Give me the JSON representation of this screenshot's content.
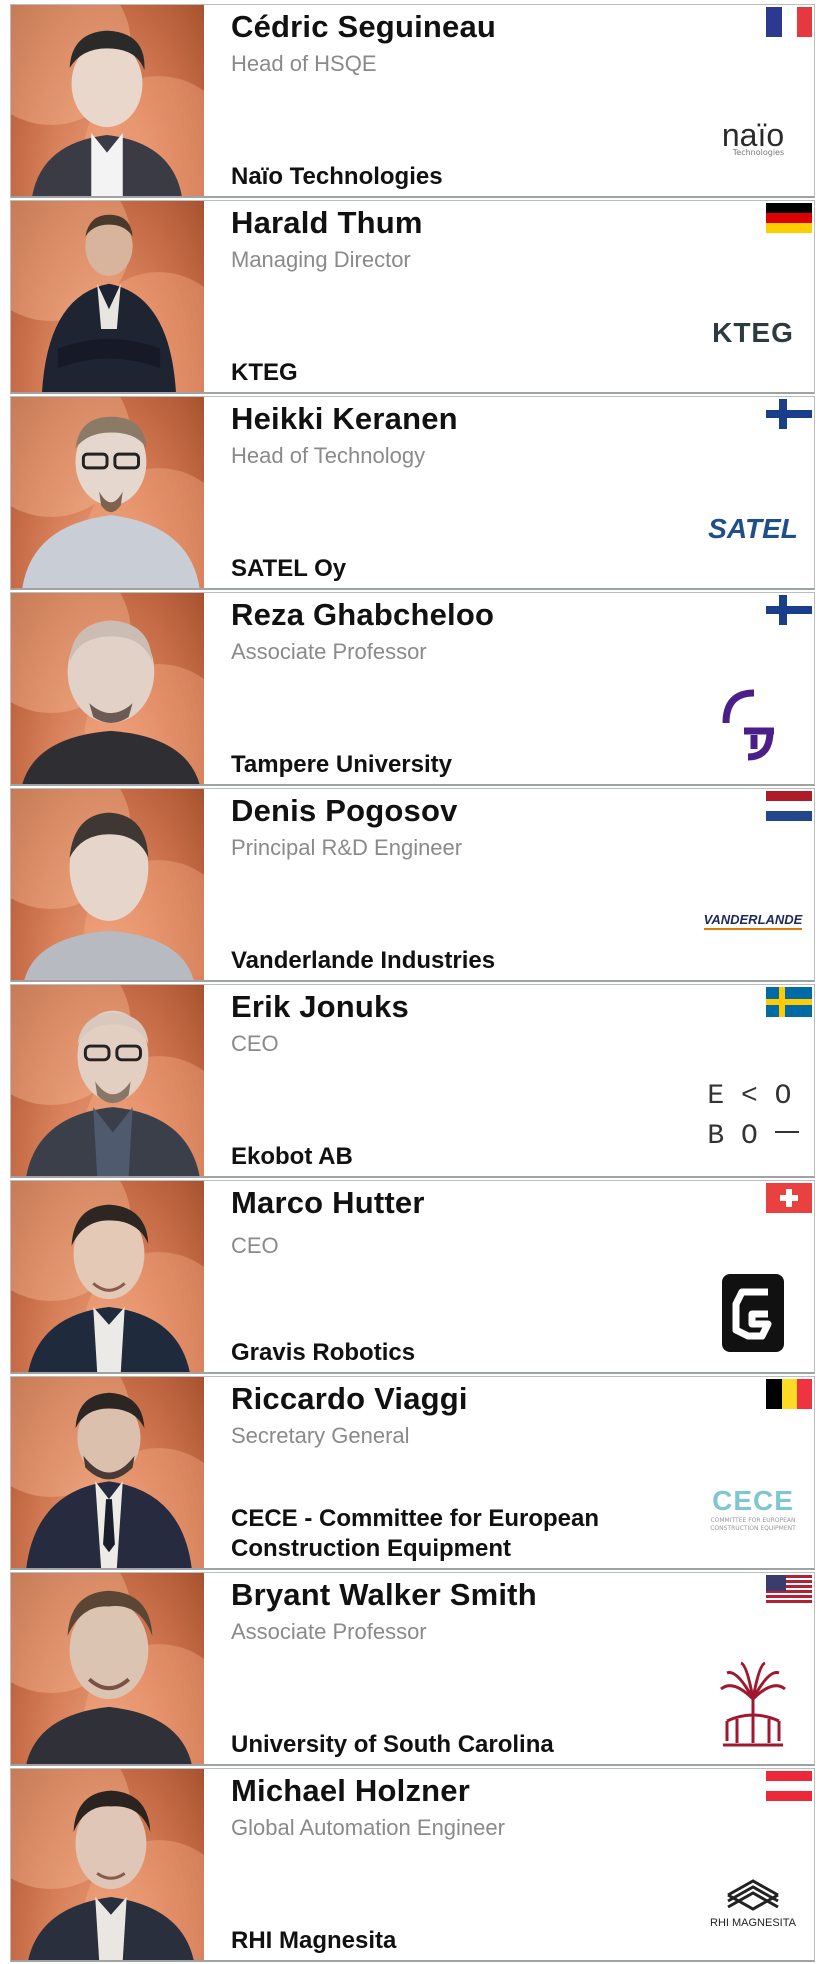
{
  "speakers": [
    {
      "name": "Cédric Seguineau",
      "role": "Head of HSQE",
      "company": "Naïo Technologies",
      "flag": "france",
      "logo_icon": "naio-logo",
      "logo_text": "naïo",
      "logo_sub": "Technologies"
    },
    {
      "name": "Harald Thum",
      "role": "Managing Director",
      "company": "KTEG",
      "flag": "germany",
      "logo_icon": "kteg-logo",
      "logo_text": "KTEG"
    },
    {
      "name": "Heikki Keranen",
      "role": "Head of Technology",
      "company": "SATEL Oy",
      "flag": "finland",
      "logo_icon": "satel-logo",
      "logo_text": "SATEL"
    },
    {
      "name": "Reza Ghabcheloo",
      "role": "Associate Professor",
      "company": "Tampere University",
      "flag": "finland",
      "logo_icon": "tampere-university-logo",
      "logo_text": ""
    },
    {
      "name": "Denis Pogosov",
      "role": "Principal R&D Engineer",
      "company": "Vanderlande Industries",
      "flag": "netherlands",
      "logo_icon": "vanderlande-logo",
      "logo_text": "VANDERLANDE"
    },
    {
      "name": "Erik Jonuks",
      "role": "CEO",
      "company": "Ekobot AB",
      "flag": "sweden",
      "logo_icon": "ekobot-logo",
      "logo_text": "E < O",
      "logo_text2": "B O"
    },
    {
      "name": "Marco Hutter",
      "role": "CEO",
      "company": "Gravis Robotics",
      "flag": "switzerland",
      "logo_icon": "gravis-robotics-logo",
      "logo_text": ""
    },
    {
      "name": "Riccardo Viaggi",
      "role": "Secretary General",
      "company": "CECE - Committee for European Construction Equipment",
      "flag": "belgium",
      "logo_icon": "cece-logo",
      "logo_text": "CECE",
      "logo_sub": "COMMITTEE FOR EUROPEAN CONSTRUCTION EQUIPMENT"
    },
    {
      "name": "Bryant Walker Smith",
      "role": "Associate Professor",
      "company": "University of South Carolina",
      "flag": "usa",
      "logo_icon": "usc-palmetto-logo",
      "logo_text": ""
    },
    {
      "name": "Michael Holzner",
      "role": "Global Automation Engineer",
      "company": "RHI Magnesita",
      "flag": "austria",
      "logo_icon": "rhi-magnesita-logo",
      "logo_text": "RHI MAGNESITA"
    }
  ],
  "colors": {
    "name": "#111111",
    "role": "#8a8a8a",
    "photo_bg": "#d9825c",
    "card_border": "#9ea4a4"
  }
}
